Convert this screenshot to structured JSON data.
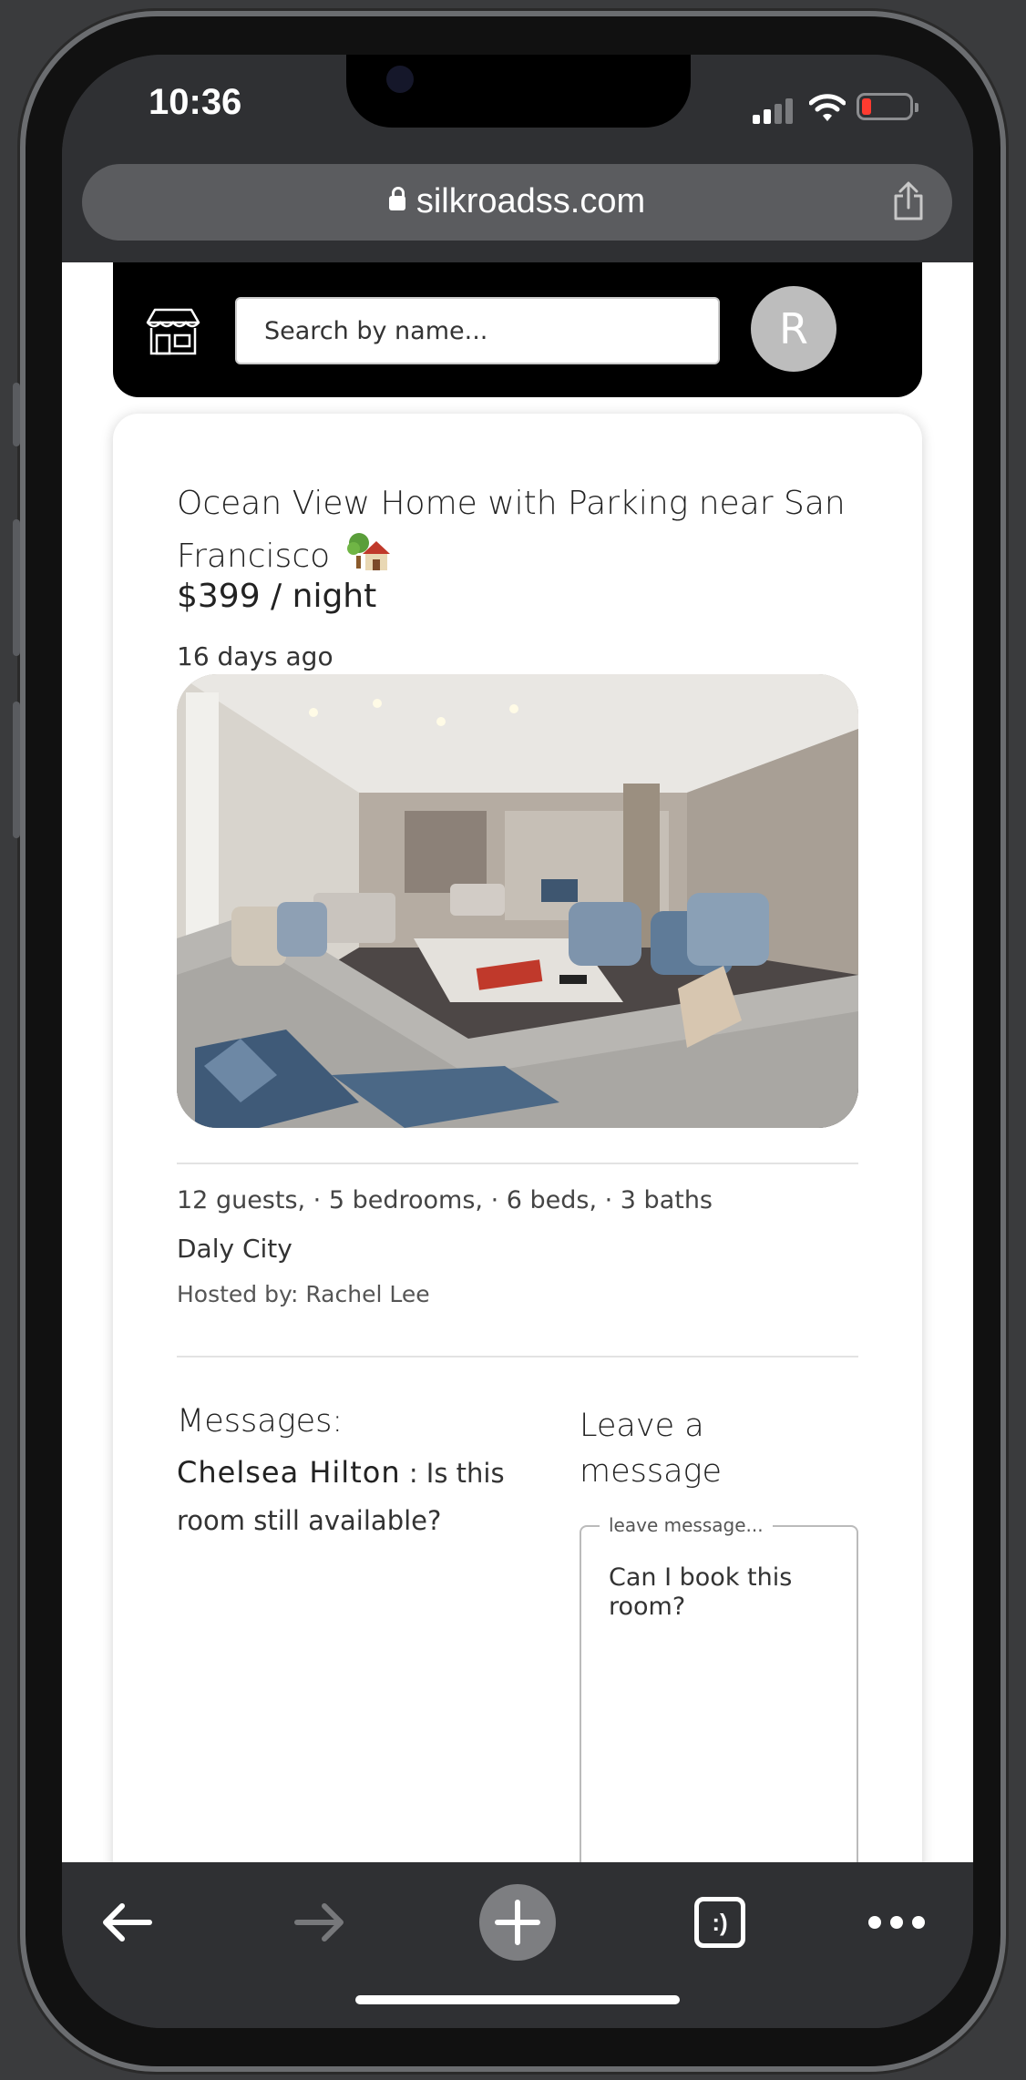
{
  "status_bar": {
    "time": "10:36"
  },
  "browser": {
    "url": "silkroadss.com"
  },
  "header": {
    "search_placeholder": "Search by name...",
    "avatar_initial": "R"
  },
  "listing": {
    "title": "Ocean View Home with Parking near San Francisco",
    "price": "$399 / night",
    "posted": "16 days ago",
    "details": "12 guests, · 5 bedrooms, · 6 beds, · 3 baths",
    "city": "Daly City",
    "host": "Hosted by: Rachel Lee"
  },
  "messages": {
    "heading": "Messages:",
    "items": [
      {
        "author": "Chelsea Hilton",
        "text": ": Is this room still available?"
      }
    ]
  },
  "leave_message": {
    "heading": "Leave a message",
    "field_label": "leave message...",
    "value": "Can I book this room?"
  },
  "toolbar": {
    "tabs_label": ":)"
  },
  "colors": {
    "browser_chrome": "#2f3033",
    "page_bg": "#ffffff",
    "header_bg": "#000000",
    "battery_low": "#ff3b30"
  }
}
